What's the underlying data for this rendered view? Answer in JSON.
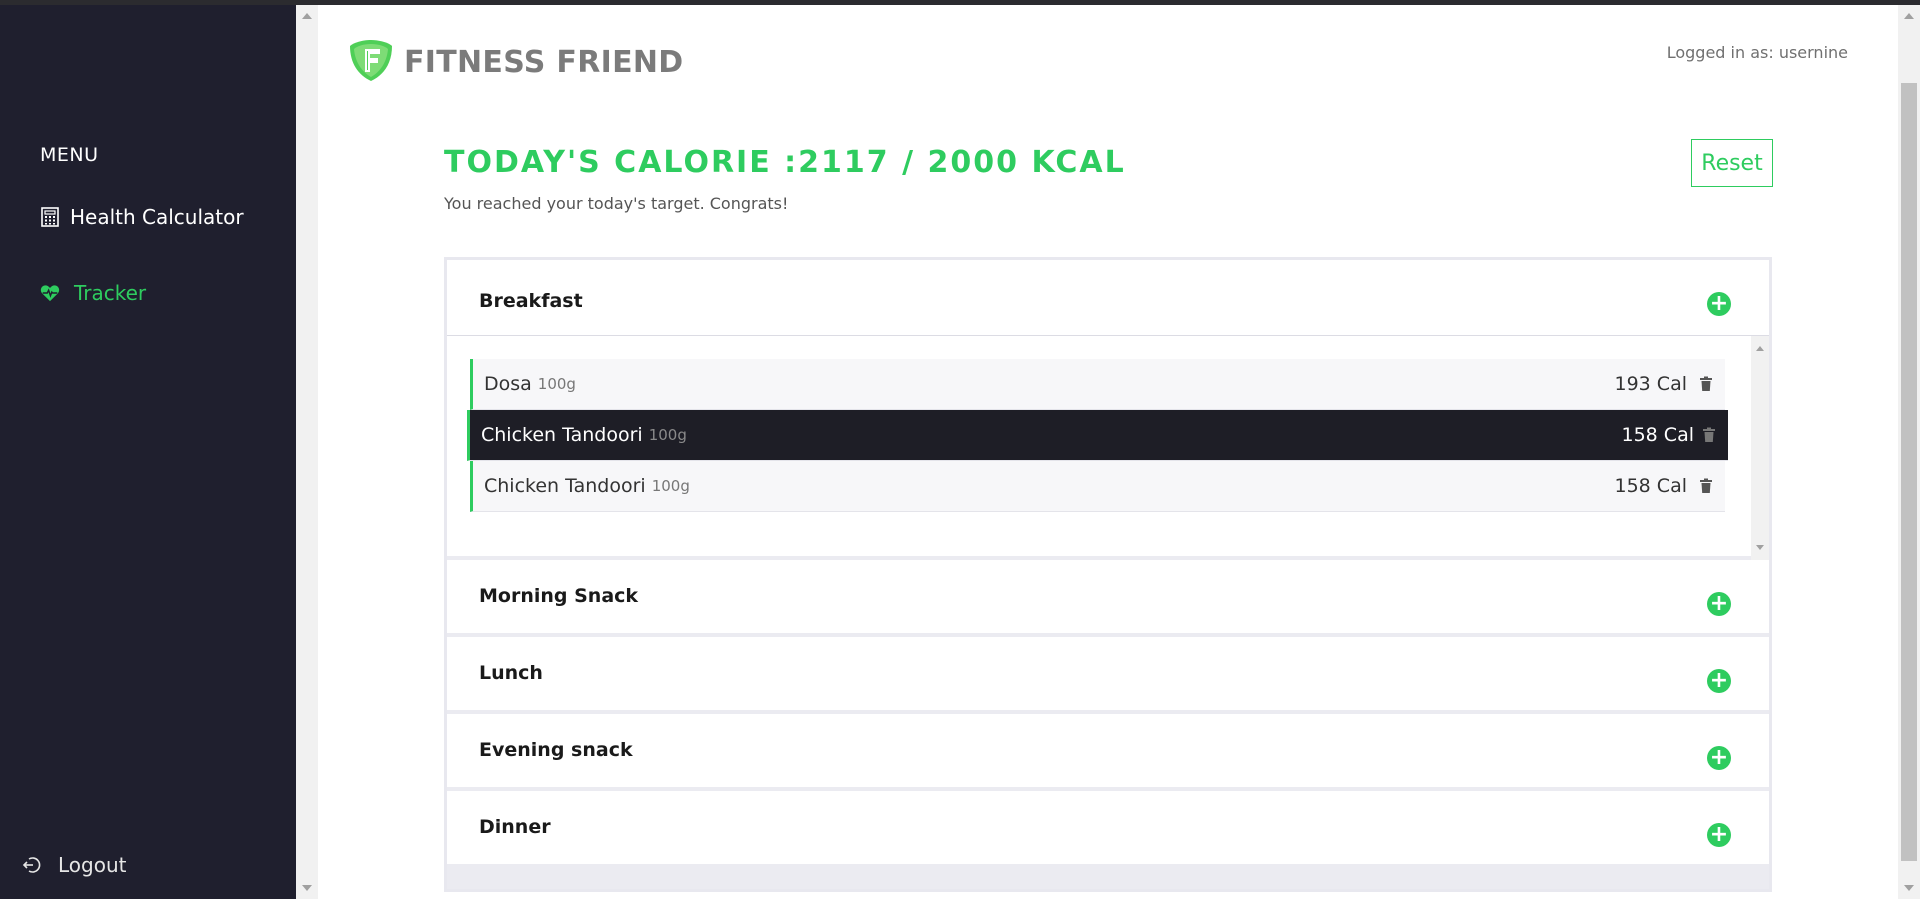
{
  "app": {
    "brand": "FITNESS FRIEND",
    "logged_in": "Logged in as: usernine"
  },
  "sidebar": {
    "menu_title": "MENU",
    "items": [
      {
        "label": "Health Calculator",
        "icon": "calculator-icon"
      },
      {
        "label": "Tracker",
        "icon": "heartbeat-icon",
        "active": true
      }
    ],
    "logout_label": "Logout"
  },
  "tracker": {
    "heading": "TODAY'S CALORIE :2117 / 2000 KCAL",
    "message": "You reached your today's target. Congrats!",
    "reset_label": "Reset",
    "meals": [
      {
        "name": "Breakfast",
        "expanded": true,
        "foods": [
          {
            "name": "Dosa",
            "qty": "100g",
            "cal": "193 Cal"
          },
          {
            "name": "Chicken Tandoori",
            "qty": "100g",
            "cal": "158 Cal"
          },
          {
            "name": "Chicken Tandoori",
            "qty": "100g",
            "cal": "158 Cal"
          }
        ]
      },
      {
        "name": "Morning Snack"
      },
      {
        "name": "Lunch"
      },
      {
        "name": "Evening snack"
      },
      {
        "name": "Dinner"
      }
    ]
  },
  "colors": {
    "accent": "#2ecc5f",
    "sidebar_bg": "#1f1f2e",
    "active_row": "#1e1e26"
  }
}
